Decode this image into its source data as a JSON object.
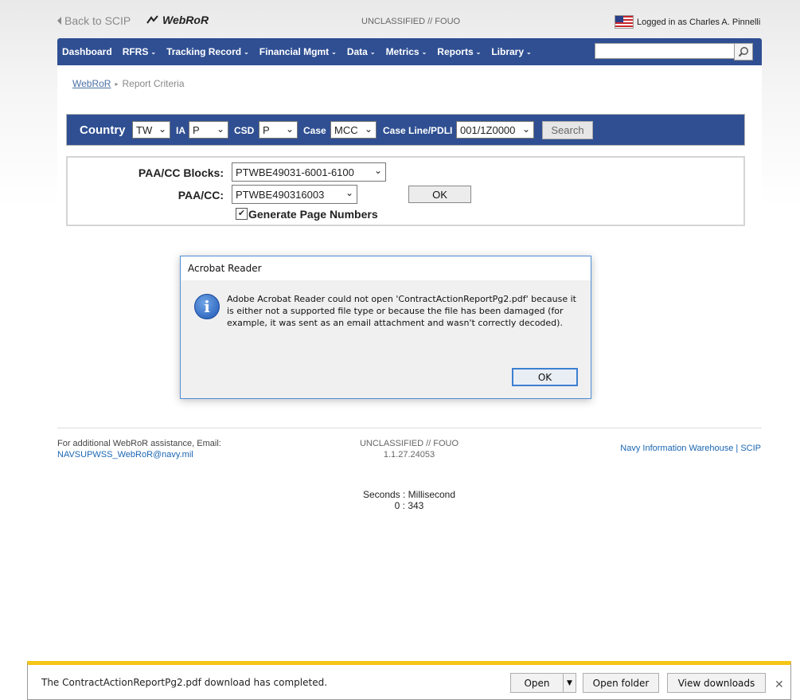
{
  "topbar": {
    "back_label": "Back to SCIP",
    "app_name": "WebRoR",
    "classification": "UNCLASSIFIED // FOUO",
    "user_label": "Logged in as Charles A. Pinnelli"
  },
  "nav": {
    "items": [
      {
        "label": "Dashboard",
        "dropdown": false
      },
      {
        "label": "RFRS",
        "dropdown": true
      },
      {
        "label": "Tracking Record",
        "dropdown": true
      },
      {
        "label": "Financial Mgmt",
        "dropdown": true
      },
      {
        "label": "Data",
        "dropdown": true
      },
      {
        "label": "Metrics",
        "dropdown": true
      },
      {
        "label": "Reports",
        "dropdown": true
      },
      {
        "label": "Library",
        "dropdown": true
      }
    ],
    "search_value": ""
  },
  "breadcrumb": {
    "root": "WebRoR",
    "current": "Report Criteria"
  },
  "filter": {
    "country_label": "Country",
    "country_value": "TW",
    "ia_label": "IA",
    "ia_value": "P",
    "csd_label": "CSD",
    "csd_value": "P",
    "case_label": "Case",
    "case_value": "MCC",
    "caseline_label": "Case Line/PDLI",
    "caseline_value": "001/1Z0000",
    "search_label": "Search"
  },
  "criteria": {
    "blocks_label": "PAA/CC Blocks:",
    "blocks_value": "PTWBE49031-6001-6100",
    "paacc_label": "PAA/CC:",
    "paacc_value": "PTWBE490316003",
    "ok_label": "OK",
    "page_numbers_label": "Generate Page Numbers",
    "page_numbers_checked": true
  },
  "footer": {
    "help_text": "For additional WebRoR assistance, Email:",
    "help_email": "NAVSUPWSS_WebRoR@navy.mil",
    "classification": "UNCLASSIFIED // FOUO",
    "version": "1.1.27.24053",
    "link_niw": "Navy Information Warehouse",
    "link_sep": "|",
    "link_scip": "SCIP"
  },
  "timing": {
    "label": "Seconds : Millisecond",
    "value": "0 : 343"
  },
  "dialog": {
    "title": "Acrobat Reader",
    "message": "Adobe Acrobat Reader could not open 'ContractActionReportPg2.pdf' because it is either not a supported file type or because the file has been damaged (for example, it was sent as an email attachment and wasn't correctly decoded).",
    "ok_label": "OK",
    "icon": "info-icon"
  },
  "download_bar": {
    "message": "The ContractActionReportPg2.pdf download has completed.",
    "open_label": "Open",
    "open_folder_label": "Open folder",
    "view_downloads_label": "View downloads"
  },
  "colors": {
    "nav_bg": "#2f4f92",
    "link": "#1a66b3",
    "dialog_border": "#4f8fd6",
    "download_accent": "#f5c518"
  }
}
